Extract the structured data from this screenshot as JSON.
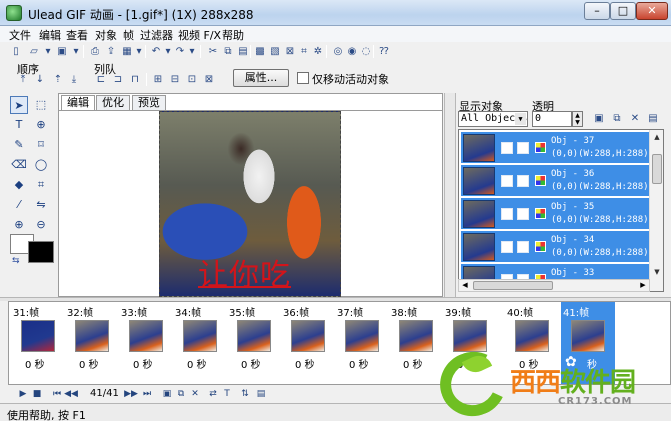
{
  "window": {
    "title": "Ulead GIF 动画 - [1.gif*] (1X) 288x288"
  },
  "menu": [
    "文件",
    "编辑",
    "查看",
    "对象",
    "帧",
    "过滤器",
    "视频 F/X",
    "帮助"
  ],
  "toolbar": {
    "group_order_label": "顺序",
    "group_queue_label": "列队",
    "properties_button": "属性...",
    "move_active_only_label": "仅移动活动对象"
  },
  "editor": {
    "tabs": [
      "编辑",
      "优化",
      "预览"
    ],
    "active_tab": "编辑",
    "canvas_caption": "让你吃"
  },
  "object_panel": {
    "show_objects_label": "显示对象",
    "opacity_label": "透明",
    "filter_value": "All Objects",
    "opacity_value": "0",
    "objects": [
      {
        "name": "Obj - 37",
        "info": "(0,0)(W:288,H:288)"
      },
      {
        "name": "Obj - 36",
        "info": "(0,0)(W:288,H:288)"
      },
      {
        "name": "Obj - 35",
        "info": "(0,0)(W:288,H:288)"
      },
      {
        "name": "Obj - 34",
        "info": "(0,0)(W:288,H:288)"
      },
      {
        "name": "Obj - 33",
        "info": ""
      }
    ]
  },
  "frames": [
    {
      "label": "31:帧",
      "delay": "0 秒"
    },
    {
      "label": "32:帧",
      "delay": "0 秒"
    },
    {
      "label": "33:帧",
      "delay": "0 秒"
    },
    {
      "label": "34:帧",
      "delay": "0 秒"
    },
    {
      "label": "35:帧",
      "delay": "0 秒"
    },
    {
      "label": "36:帧",
      "delay": "0 秒"
    },
    {
      "label": "37:帧",
      "delay": "0 秒"
    },
    {
      "label": "38:帧",
      "delay": "0 秒"
    },
    {
      "label": "39:帧",
      "delay": "0 秒"
    },
    {
      "label": "40:帧",
      "delay": "0 秒"
    },
    {
      "label": "41:帧",
      "delay": "秒"
    }
  ],
  "playback": {
    "frame_counter": "41/41"
  },
  "status": {
    "text": "使用帮助, 按 F1"
  },
  "watermark": {
    "text_a": "西西",
    "text_b": "软件园",
    "sub": "CR173.COM"
  },
  "colors": {
    "selection": "#3e8ee6",
    "caption": "#d2141a",
    "logo_green": "#6fbf22",
    "logo_orange": "#f07d18"
  }
}
